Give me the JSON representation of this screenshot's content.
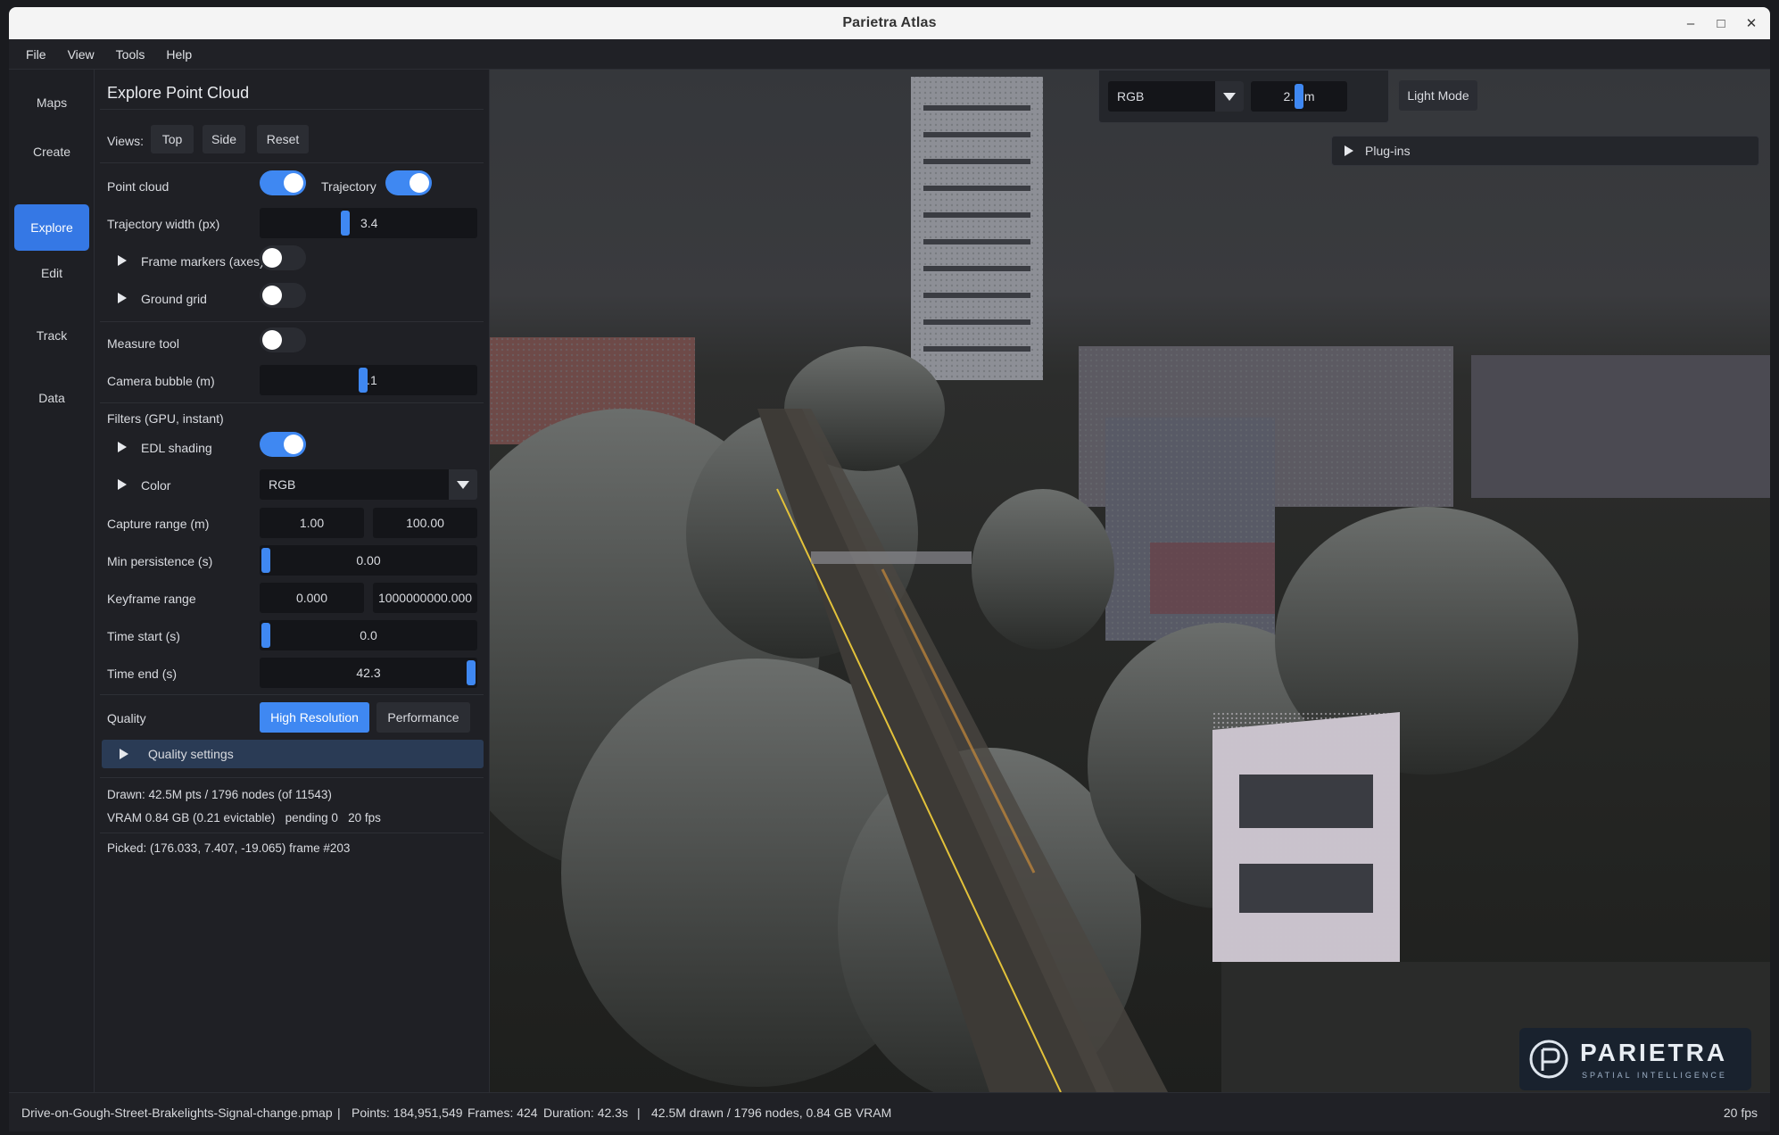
{
  "window": {
    "title": "Parietra Atlas",
    "controls": [
      "–",
      "□",
      "✕"
    ]
  },
  "menu": [
    "File",
    "View",
    "Tools",
    "Help"
  ],
  "nav": [
    "Maps",
    "Create",
    "Explore",
    "Edit",
    "Track",
    "Data"
  ],
  "nav_active": "Explore",
  "panel": {
    "title": "Explore Point Cloud",
    "views_label": "Views:",
    "views": [
      "Top",
      "Side",
      "Reset"
    ],
    "point_cloud_label": "Point cloud",
    "point_cloud_on": true,
    "trajectory_label": "Trajectory",
    "trajectory_on": true,
    "traj_width_label": "Trajectory width (px)",
    "traj_width_value": "3.4",
    "frame_markers_label": "Frame markers (axes)",
    "frame_markers_on": false,
    "ground_grid_label": "Ground grid",
    "ground_grid_on": false,
    "measure_label": "Measure tool",
    "measure_on": false,
    "camera_bubble_label": "Camera bubble (m)",
    "camera_bubble_value": "2.1",
    "filters_label": "Filters (GPU, instant)",
    "edl_label": "EDL shading",
    "edl_on": true,
    "color_label": "Color",
    "color_value": "RGB",
    "capture_label": "Capture range (m)",
    "capture_min": "1.00",
    "capture_max": "100.00",
    "persistence_label": "Min persistence (s)",
    "persistence_value": "0.00",
    "keyframe_label": "Keyframe range",
    "keyframe_min": "0.000",
    "keyframe_max": "1000000000.000",
    "time_start_label": "Time start (s)",
    "time_start_value": "0.0",
    "time_end_label": "Time end (s)",
    "time_end_value": "42.3",
    "quality_label": "Quality",
    "quality_options": [
      "High Resolution",
      "Performance"
    ],
    "quality_selected": "High Resolution",
    "quality_settings_label": "Quality settings",
    "stats_line1": "Drawn: 42.5M pts / 1796 nodes (of 11543)",
    "stats_line2": "VRAM 0.84 GB (0.21 evictable)   pending 0   20 fps",
    "picked": "Picked: (176.033, 7.407, -19.065)  frame #203"
  },
  "viewport": {
    "color_mode": "RGB",
    "bubble": "2.1 m",
    "light_mode": "Light Mode",
    "plugins": "Plug-ins",
    "logo_name": "PARIETRA",
    "logo_tagline": "SPATIAL INTELLIGENCE"
  },
  "status": {
    "file": "Drive-on-Gough-Street-Brakelights-Signal-change.pmap",
    "points": "Points: 184,951,549",
    "frames": "Frames: 424",
    "duration": "Duration: 42.3s",
    "drawn": "42.5M drawn / 1796 nodes, 0.84 GB VRAM",
    "fps": "20 fps"
  },
  "colors": {
    "accent": "#3f88f2",
    "active_nav": "#3578e5",
    "panel_bg": "#1f2025"
  }
}
